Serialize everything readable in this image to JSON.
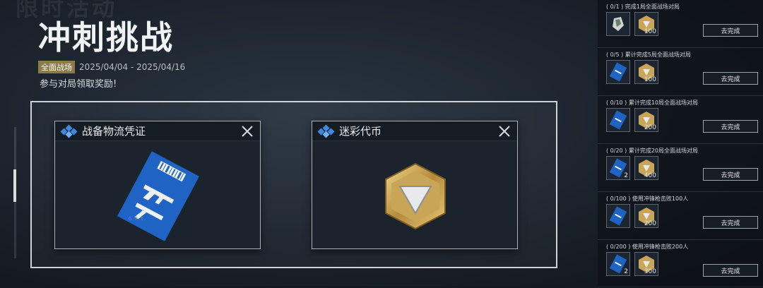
{
  "event": {
    "ghost_title": "限时活动",
    "title": "冲刺挑战",
    "badge": "全面战场",
    "date_range": "2025/04/04 - 2025/04/16",
    "description": "参与对局领取奖励!"
  },
  "cards": [
    {
      "title": "战备物流凭证",
      "item": "gti-ticket-icon"
    },
    {
      "title": "迷彩代币",
      "item": "camo-token-icon"
    }
  ],
  "tasks": [
    {
      "label": "( 0/1 ) 完成1局全面战场对局",
      "items": [
        {
          "icon": "gloves-icon",
          "qty": ""
        },
        {
          "icon": "camo-token-icon",
          "qty": "100"
        }
      ],
      "button": "去完成"
    },
    {
      "label": "( 0/5 ) 累计完成5局全面战场对局",
      "items": [
        {
          "icon": "gti-ticket-icon",
          "qty": ""
        },
        {
          "icon": "camo-token-icon",
          "qty": "100"
        }
      ],
      "button": "去完成"
    },
    {
      "label": "( 0/10 ) 累计完成10局全面战场对局",
      "items": [
        {
          "icon": "gti-ticket-icon",
          "qty": ""
        },
        {
          "icon": "camo-token-icon",
          "qty": "200"
        }
      ],
      "button": "去完成"
    },
    {
      "label": "( 0/20 ) 累计完成20局全面战场对局",
      "items": [
        {
          "icon": "gti-ticket-icon",
          "qty": "2"
        },
        {
          "icon": "camo-token-icon",
          "qty": "400"
        }
      ],
      "button": "去完成"
    },
    {
      "label": "( 0/100 ) 使用冲锋枪击败100人",
      "items": [
        {
          "icon": "gti-ticket-icon",
          "qty": ""
        },
        {
          "icon": "camo-token-icon",
          "qty": "200"
        }
      ],
      "button": "去完成"
    },
    {
      "label": "( 0/200 ) 使用冲锋枪击败200人",
      "items": [
        {
          "icon": "gti-ticket-icon",
          "qty": "2"
        },
        {
          "icon": "camo-token-icon",
          "qty": "300"
        }
      ],
      "button": "去完成"
    }
  ],
  "colors": {
    "accent_blue": "#3d8ae5",
    "gold": "#c9a557",
    "badge": "#8c7a48"
  }
}
